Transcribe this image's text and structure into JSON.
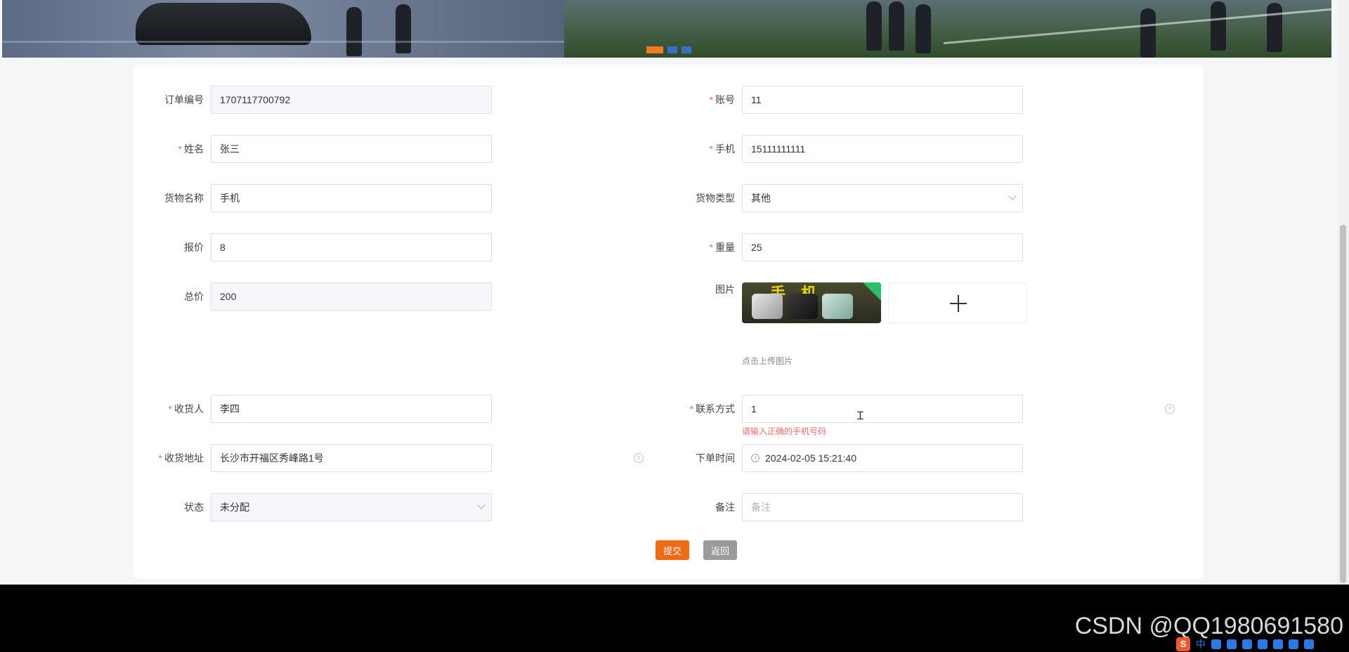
{
  "carousel": {
    "dots": 3,
    "active_index": 0
  },
  "form": {
    "order_no": {
      "label": "订单编号",
      "value": "1707117700792",
      "disabled": true,
      "required": false
    },
    "account": {
      "label": "账号",
      "value": "11",
      "required": true
    },
    "name": {
      "label": "姓名",
      "value": "张三",
      "required": true
    },
    "phone": {
      "label": "手机",
      "value": "15111111111",
      "required": true
    },
    "goods_name": {
      "label": "货物名称",
      "value": "手机",
      "required": false
    },
    "goods_type": {
      "label": "货物类型",
      "value": "其他",
      "required": false
    },
    "quote": {
      "label": "报价",
      "value": "8",
      "required": false
    },
    "weight": {
      "label": "重量",
      "value": "25",
      "required": true
    },
    "total": {
      "label": "总价",
      "value": "200",
      "disabled": true,
      "required": false
    },
    "image": {
      "label": "图片",
      "hint": "点击上传图片",
      "thumb_text": "手机"
    },
    "receiver": {
      "label": "收货人",
      "value": "李四",
      "required": true
    },
    "contact": {
      "label": "联系方式",
      "value": "1",
      "required": true,
      "error": "请输入正确的手机号码"
    },
    "address": {
      "label": "收货地址",
      "value": "长沙市开福区秀峰路1号",
      "required": true
    },
    "order_time": {
      "label": "下单时间",
      "value": "2024-02-05 15:21:40",
      "required": false
    },
    "status": {
      "label": "状态",
      "value": "未分配",
      "required": false
    },
    "remark": {
      "label": "备注",
      "placeholder": "备注",
      "required": false
    }
  },
  "buttons": {
    "submit": "提交",
    "back": "返回"
  },
  "required_mark": "*",
  "watermark": "CSDN @QQ1980691580",
  "ime": {
    "logo": "S",
    "lang": "中"
  },
  "colors": {
    "primary": "#ef6a15",
    "error": "#f56c6c",
    "secondary": "#9a9a9a"
  }
}
